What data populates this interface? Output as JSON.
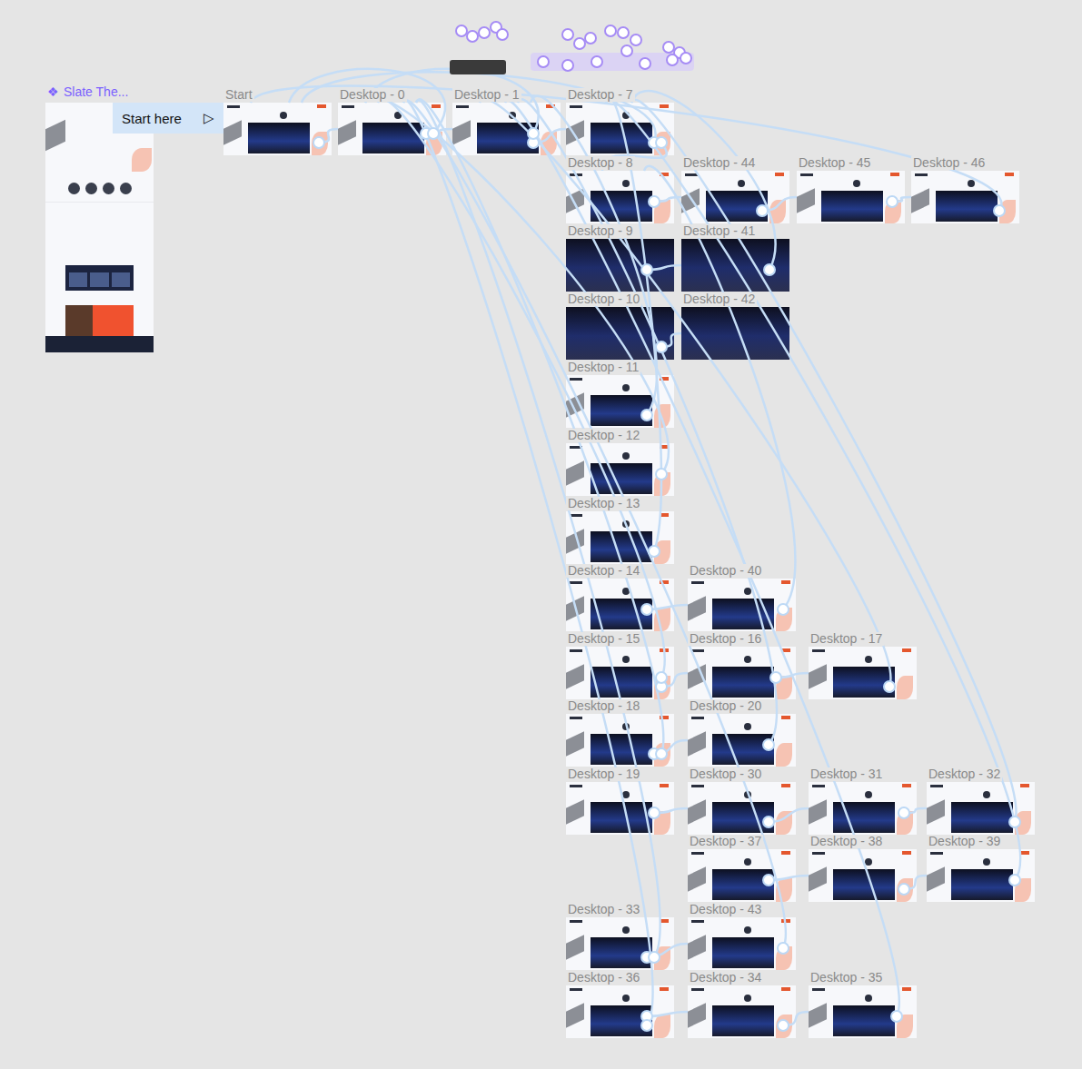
{
  "canvas": {
    "component": {
      "label": "Slate The...",
      "icon": "❖"
    },
    "flow_start": {
      "label": "Start here",
      "icon": "▷"
    }
  },
  "frames": [
    {
      "label": "Start",
      "kind": "page"
    },
    {
      "label": "Desktop - 0",
      "kind": "page"
    },
    {
      "label": "Desktop - 1",
      "kind": "page"
    },
    {
      "label": "Desktop - 7",
      "kind": "page"
    },
    {
      "label": "Desktop - 8",
      "kind": "page"
    },
    {
      "label": "Desktop - 44",
      "kind": "page"
    },
    {
      "label": "Desktop - 45",
      "kind": "page"
    },
    {
      "label": "Desktop - 46",
      "kind": "page"
    },
    {
      "label": "Desktop - 9",
      "kind": "dark"
    },
    {
      "label": "Desktop - 41",
      "kind": "dark"
    },
    {
      "label": "Desktop - 10",
      "kind": "dark"
    },
    {
      "label": "Desktop - 42",
      "kind": "dark"
    },
    {
      "label": "Desktop - 11",
      "kind": "page"
    },
    {
      "label": "Desktop - 12",
      "kind": "page"
    },
    {
      "label": "Desktop - 13",
      "kind": "page"
    },
    {
      "label": "Desktop - 14",
      "kind": "page"
    },
    {
      "label": "Desktop - 40",
      "kind": "page"
    },
    {
      "label": "Desktop - 15",
      "kind": "page"
    },
    {
      "label": "Desktop - 16",
      "kind": "page"
    },
    {
      "label": "Desktop - 17",
      "kind": "page"
    },
    {
      "label": "Desktop - 18",
      "kind": "page"
    },
    {
      "label": "Desktop - 20",
      "kind": "page"
    },
    {
      "label": "Desktop - 19",
      "kind": "page"
    },
    {
      "label": "Desktop - 30",
      "kind": "page"
    },
    {
      "label": "Desktop - 31",
      "kind": "page"
    },
    {
      "label": "Desktop - 32",
      "kind": "page"
    },
    {
      "label": "Desktop - 37",
      "kind": "page"
    },
    {
      "label": "Desktop - 38",
      "kind": "page"
    },
    {
      "label": "Desktop - 39",
      "kind": "page"
    },
    {
      "label": "Desktop - 33",
      "kind": "page"
    },
    {
      "label": "Desktop - 43",
      "kind": "page"
    },
    {
      "label": "Desktop - 36",
      "kind": "page"
    },
    {
      "label": "Desktop - 34",
      "kind": "page"
    },
    {
      "label": "Desktop - 35",
      "kind": "page"
    }
  ],
  "connections": [
    {
      "from": "Start",
      "to": "Desktop - 0"
    },
    {
      "from": "Desktop - 0",
      "to": "Desktop - 1"
    },
    {
      "from": "Desktop - 1",
      "to": "Desktop - 7"
    },
    {
      "from": "Desktop - 0",
      "to": "Start"
    },
    {
      "from": "Desktop - 7",
      "to": "Start"
    },
    {
      "from": "Desktop - 1",
      "to": "Desktop - 0"
    },
    {
      "from": "Desktop - 7",
      "to": "Desktop - 8"
    },
    {
      "from": "Desktop - 8",
      "to": "Desktop - 44"
    },
    {
      "from": "Desktop - 44",
      "to": "Desktop - 45"
    },
    {
      "from": "Desktop - 45",
      "to": "Desktop - 46"
    },
    {
      "from": "Desktop - 46",
      "to": "Start"
    },
    {
      "from": "Desktop - 9",
      "to": "Desktop - 41"
    },
    {
      "from": "Desktop - 10",
      "to": "Desktop - 42"
    },
    {
      "from": "Desktop - 41",
      "to": "Desktop - 7"
    },
    {
      "from": "Desktop - 11",
      "to": "Desktop - 1"
    },
    {
      "from": "Desktop - 12",
      "to": "Desktop - 0"
    },
    {
      "from": "Desktop - 13",
      "to": "Desktop - 7"
    },
    {
      "from": "Desktop - 14",
      "to": "Desktop - 40"
    },
    {
      "from": "Desktop - 15",
      "to": "Desktop - 16"
    },
    {
      "from": "Desktop - 16",
      "to": "Desktop - 17"
    },
    {
      "from": "Desktop - 17",
      "to": "Desktop - 1"
    },
    {
      "from": "Desktop - 15",
      "to": "Desktop - 0"
    },
    {
      "from": "Desktop - 18",
      "to": "Desktop - 20"
    },
    {
      "from": "Desktop - 20",
      "to": "Desktop - 1"
    },
    {
      "from": "Desktop - 18",
      "to": "Desktop - 0"
    },
    {
      "from": "Desktop - 19",
      "to": "Desktop - 30"
    },
    {
      "from": "Desktop - 30",
      "to": "Desktop - 31"
    },
    {
      "from": "Desktop - 31",
      "to": "Desktop - 32"
    },
    {
      "from": "Desktop - 32",
      "to": "Desktop - 7"
    },
    {
      "from": "Desktop - 37",
      "to": "Desktop - 38"
    },
    {
      "from": "Desktop - 38",
      "to": "Desktop - 39"
    },
    {
      "from": "Desktop - 39",
      "to": "Desktop - 7"
    },
    {
      "from": "Desktop - 33",
      "to": "Desktop - 43"
    },
    {
      "from": "Desktop - 43",
      "to": "Desktop - 0"
    },
    {
      "from": "Desktop - 33",
      "to": "Desktop - 0"
    },
    {
      "from": "Desktop - 36",
      "to": "Desktop - 34"
    },
    {
      "from": "Desktop - 34",
      "to": "Desktop - 35"
    },
    {
      "from": "Desktop - 35",
      "to": "Desktop - 1"
    },
    {
      "from": "Desktop - 36",
      "to": "Desktop - 0"
    },
    {
      "from": "Desktop - 40",
      "to": "Desktop - 8"
    }
  ]
}
